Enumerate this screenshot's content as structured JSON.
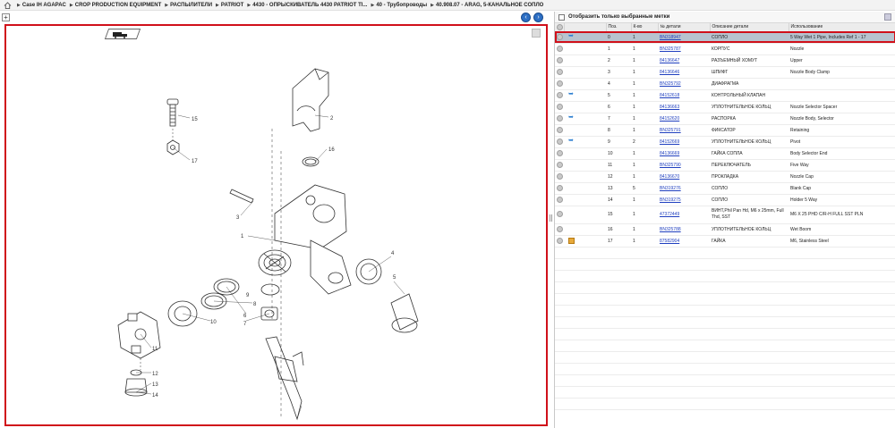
{
  "breadcrumb": {
    "items": [
      "Case IH AGAPAC",
      "CROP PRODUCTION EQUIPMENT",
      "РАСПЫЛИТЕЛИ",
      "PATRIOT",
      "4430 - ОПРЫСКИВАТЕЛЬ 4430 PATRIOT TI...",
      "40 - Трубопроводы",
      "40.908.07 - ARAG, 5-КАНАЛЬНОЕ СОПЛО"
    ]
  },
  "filter": {
    "label": "Отобразить только выбранные метки"
  },
  "table": {
    "headers": [
      "Поз.",
      "К-во",
      "№ детали",
      "Описание детали",
      "Использование"
    ],
    "rows": [
      {
        "pos": "0",
        "qty": "1",
        "part": "BN318947",
        "desc": "СОПЛО",
        "usage": "5 Way Wet 1 Pipe, Includes Ref 1 - 17",
        "icon": "arrow-icon"
      },
      {
        "pos": "1",
        "qty": "1",
        "part": "BN325787",
        "desc": "КОРПУС",
        "usage": "Nozzle",
        "icon": ""
      },
      {
        "pos": "2",
        "qty": "1",
        "part": "84136647",
        "desc": "РАЗЪЕМНЫЙ ХОМУТ",
        "usage": "Upper",
        "icon": ""
      },
      {
        "pos": "3",
        "qty": "1",
        "part": "84136646",
        "desc": "ШПИФТ",
        "usage": "Nozzle Body Clamp",
        "icon": ""
      },
      {
        "pos": "4",
        "qty": "1",
        "part": "BN325792",
        "desc": "ДИАФРАГМА",
        "usage": "",
        "icon": ""
      },
      {
        "pos": "5",
        "qty": "1",
        "part": "84152618",
        "desc": "КОНТРОЛЬНЫЙ КЛАПАН",
        "usage": "",
        "icon": "arrow-icon"
      },
      {
        "pos": "6",
        "qty": "1",
        "part": "84136663",
        "desc": "УПЛОТНИТЕЛЬНОЕ КОЛЬЦ",
        "usage": "Nozzle Selector Spacer",
        "icon": ""
      },
      {
        "pos": "7",
        "qty": "1",
        "part": "84152620",
        "desc": "РАСПОРКА",
        "usage": "Nozzle Body, Selector",
        "icon": "arrow-icon"
      },
      {
        "pos": "8",
        "qty": "1",
        "part": "BN325791",
        "desc": "ФИКСАТОР",
        "usage": "Retaining",
        "icon": ""
      },
      {
        "pos": "9",
        "qty": "2",
        "part": "84152669",
        "desc": "УПЛОТНИТЕЛЬНОЕ КОЛЬЦ",
        "usage": "Pivot",
        "icon": "arrow-icon"
      },
      {
        "pos": "10",
        "qty": "1",
        "part": "84136669",
        "desc": "ГАЙКА СОПЛА",
        "usage": "Body Selector End",
        "icon": ""
      },
      {
        "pos": "11",
        "qty": "1",
        "part": "BN325790",
        "desc": "ПЕРЕКЛЮЧАТЕЛЬ",
        "usage": "Five Way",
        "icon": ""
      },
      {
        "pos": "12",
        "qty": "1",
        "part": "84136670",
        "desc": "ПРОКЛАДКА",
        "usage": "Nozzle Cap",
        "icon": ""
      },
      {
        "pos": "13",
        "qty": "5",
        "part": "BN319276",
        "desc": "СОПЛО",
        "usage": "Blank Cap",
        "icon": ""
      },
      {
        "pos": "14",
        "qty": "1",
        "part": "BN319275",
        "desc": "СОПЛО",
        "usage": "Holder 5 Way",
        "icon": ""
      },
      {
        "pos": "15",
        "qty": "1",
        "part": "47372449",
        "desc": "ВИНТ,Phil Pan Hd, M6 x 25mm, Full Thd, SST",
        "usage": "M6 X 25 PHD C/R-H FULL SST PLN",
        "icon": ""
      },
      {
        "pos": "16",
        "qty": "1",
        "part": "BN325788",
        "desc": "УПЛОТНИТЕЛЬНОЕ КОЛЬЦ",
        "usage": "Wet Boom",
        "icon": ""
      },
      {
        "pos": "17",
        "qty": "1",
        "part": "87582904",
        "desc": "ГАЙКА",
        "usage": "M6, Stainless Steel",
        "icon": "box-icon"
      }
    ]
  },
  "diagram": {
    "callouts": [
      "1",
      "2",
      "3",
      "4",
      "5",
      "6",
      "7",
      "8",
      "9",
      "10",
      "11",
      "12",
      "13",
      "14",
      "15",
      "16",
      "17"
    ]
  }
}
